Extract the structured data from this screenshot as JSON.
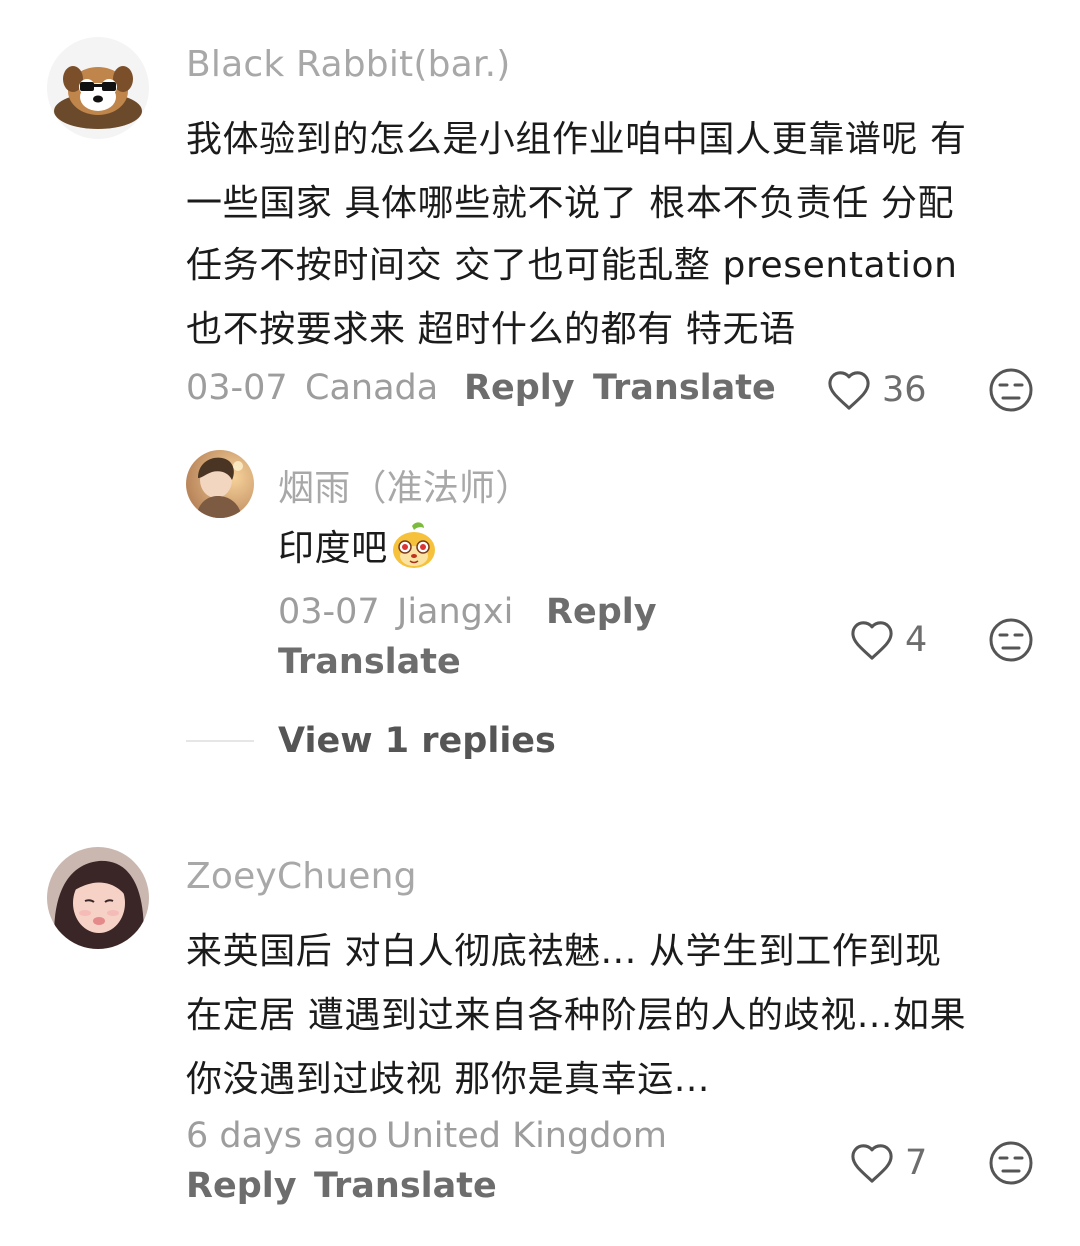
{
  "comments": [
    {
      "username": "Black Rabbit(bar.)",
      "text_lines": [
        "我体验到的怎么是小组作业咱中国人更靠谱呢 有",
        "一些国家 具体哪些就不说了 根本不负责任 分配",
        "任务不按时间交 交了也可能乱整 presentation",
        "也不按要求来 超时什么的都有 特无语"
      ],
      "date": "03-07",
      "location": "Canada",
      "reply_label": "Reply",
      "translate_label": "Translate",
      "likes": "36",
      "avatar_icon": "cartoon-dog-avatar"
    },
    {
      "username": "烟雨（准法师）",
      "text": "印度吧",
      "emoji_icon": "yellow-cartoon-emoji",
      "date": "03-07",
      "location": "Jiangxi",
      "reply_label": "Reply",
      "translate_label": "Translate",
      "likes": "4",
      "avatar_icon": "anime-boy-avatar"
    },
    {
      "username": "ZoeyChueng",
      "text_lines": [
        "来英国后 对白人彻底祛魅... 从学生到工作到现",
        "在定居 遭遇到过来自各种阶层的人的歧视...如果",
        "你没遇到过歧视 那你是真幸运..."
      ],
      "date": "6 days ago",
      "location": "United Kingdom",
      "reply_label": "Reply",
      "translate_label": "Translate",
      "likes": "7",
      "avatar_icon": "girl-photo-avatar"
    }
  ],
  "view_replies_label": "View 1 replies",
  "colors": {
    "username": "#a8a8a8",
    "body_text": "#1b1b1b",
    "meta": "#9d9d9d",
    "action": "#6d6d6d",
    "icon": "#555555"
  }
}
